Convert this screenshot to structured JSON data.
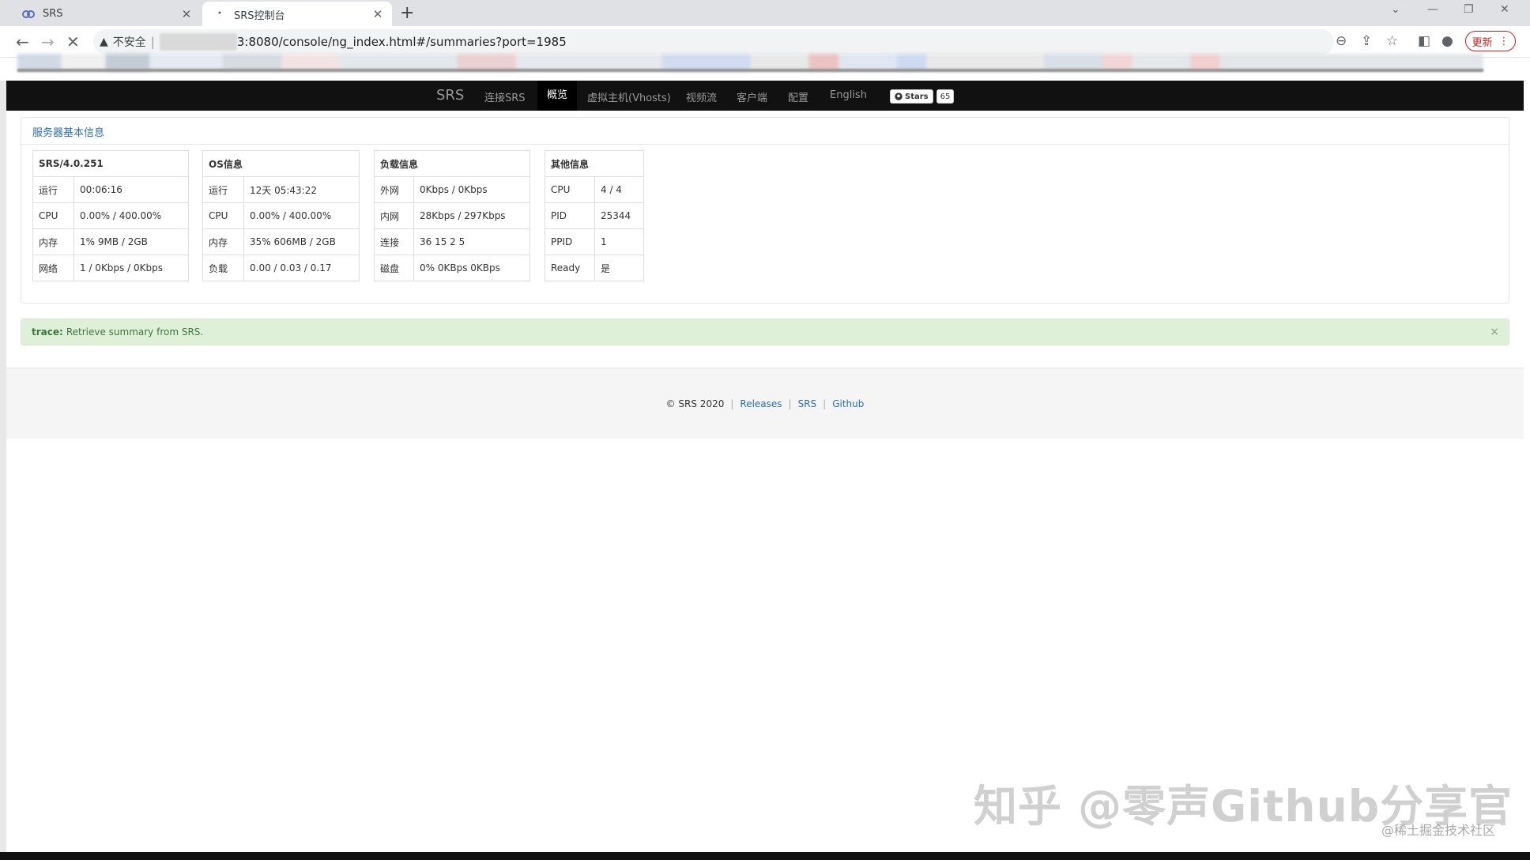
{
  "browser": {
    "tabs": [
      {
        "title": "SRS",
        "icon": "srs-favicon"
      },
      {
        "title": "SRS控制台",
        "icon": "loading-dot"
      }
    ],
    "insecure_label": "不安全",
    "url": "3:8080/console/ng_index.html#/summaries?port=1985",
    "update_label": "更新"
  },
  "navbar": {
    "brand": "SRS",
    "links": [
      "连接SRS",
      "概览",
      "虚拟主机(Vhosts)",
      "视频流",
      "客户端",
      "配置",
      "English"
    ],
    "active": "概览",
    "github": {
      "label": "Stars",
      "count": "65"
    }
  },
  "panel": {
    "title": "服务器基本信息",
    "tables": [
      {
        "header": "SRS/4.0.251",
        "rows": [
          [
            "运行",
            "00:06:16"
          ],
          [
            "CPU",
            "0.00% / 400.00%"
          ],
          [
            "内存",
            "1% 9MB / 2GB"
          ],
          [
            "网络",
            "1 / 0Kbps / 0Kbps"
          ]
        ]
      },
      {
        "header": "OS信息",
        "rows": [
          [
            "运行",
            "12天 05:43:22"
          ],
          [
            "CPU",
            "0.00% / 400.00%"
          ],
          [
            "内存",
            "35% 606MB / 2GB"
          ],
          [
            "负载",
            "0.00 / 0.03 / 0.17"
          ]
        ]
      },
      {
        "header": "负载信息",
        "rows": [
          [
            "外网",
            "0Kbps / 0Kbps"
          ],
          [
            "内网",
            "28Kbps / 297Kbps"
          ],
          [
            "连接",
            "36 15 2 5"
          ],
          [
            "磁盘",
            "0% 0KBps 0KBps"
          ]
        ]
      },
      {
        "header": "其他信息",
        "rows": [
          [
            "CPU",
            "4 / 4"
          ],
          [
            "PID",
            "25344"
          ],
          [
            "PPID",
            "1"
          ],
          [
            "Ready",
            "是"
          ]
        ]
      }
    ]
  },
  "alert": {
    "label": "trace:",
    "message": "Retrieve summary from SRS.",
    "close": "×"
  },
  "footer": {
    "copyright": "© SRS 2020",
    "links": [
      "Releases",
      "SRS",
      "Github"
    ]
  },
  "watermark": {
    "main": "知乎 @零声Github分享官",
    "sub": "@稀土掘金技术社区"
  }
}
